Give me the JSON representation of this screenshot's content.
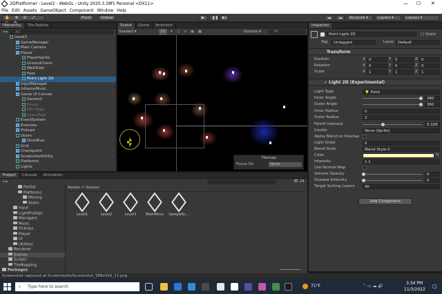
{
  "window": {
    "title": "2DPlatformer - Level2 - WebGL - Unity 2020.3.38f1 Personal <DX11>"
  },
  "menu": [
    "File",
    "Edit",
    "Assets",
    "GameObject",
    "Component",
    "Window",
    "Help"
  ],
  "toolbar": {
    "pivot": "Pivot",
    "global": "Global",
    "account": "Account",
    "layers": "Layers",
    "layout": "Layout"
  },
  "hierarchy": {
    "tabs": [
      "Hierarchy",
      "Tile Palette"
    ],
    "search_placeholder": "All",
    "items": [
      {
        "label": "Level2",
        "depth": 0
      },
      {
        "label": "GameManager",
        "depth": 1
      },
      {
        "label": "Main Camera",
        "depth": 1
      },
      {
        "label": "Player",
        "depth": 1
      },
      {
        "label": "PlayerSprite",
        "depth": 2
      },
      {
        "label": "GroundCheck",
        "depth": 2
      },
      {
        "label": "WallSlide",
        "depth": 2
      },
      {
        "label": "Feet",
        "depth": 2
      },
      {
        "label": "Point Light 2D",
        "depth": 2
      },
      {
        "label": "InputManager",
        "depth": 1
      },
      {
        "label": "InGameMusic",
        "depth": 1
      },
      {
        "label": "Game UI Canvas",
        "depth": 1
      },
      {
        "label": "GameUI",
        "depth": 2
      },
      {
        "label": "Pause",
        "depth": 2
      },
      {
        "label": "Win Page",
        "depth": 2
      },
      {
        "label": "Lose Page",
        "depth": 2
      },
      {
        "label": "EventSystem",
        "depth": 1
      },
      {
        "label": "Enemies",
        "depth": 1
      },
      {
        "label": "Pickups",
        "depth": 1
      },
      {
        "label": "Doors",
        "depth": 1
      },
      {
        "label": "DoorBlue",
        "depth": 2
      },
      {
        "label": "Grid",
        "depth": 1
      },
      {
        "label": "Checkpoint",
        "depth": 1
      },
      {
        "label": "ScreenshotUtility",
        "depth": 1
      },
      {
        "label": "Platforms",
        "depth": 1
      },
      {
        "label": "Lights",
        "depth": 1
      }
    ]
  },
  "scene": {
    "tabs": [
      "Scene",
      "Game",
      "Animator"
    ],
    "shading": "Shaded",
    "mode": "2D",
    "gizmos": "Gizmos",
    "search": "All",
    "tilemap": {
      "title": "Tilemap",
      "focus_label": "Focus On",
      "focus_value": "None"
    }
  },
  "inspector": {
    "tab": "Inspector",
    "object_name": "Point Light 2D",
    "static_label": "Static",
    "tag_label": "Tag",
    "tag": "Untagged",
    "layer_label": "Layer",
    "layer": "Default",
    "transform": {
      "title": "Transform",
      "rows": [
        {
          "label": "Position",
          "x": "0",
          "y": "0",
          "z": "0"
        },
        {
          "label": "Rotation",
          "x": "0",
          "y": "0",
          "z": "0"
        },
        {
          "label": "Scale",
          "x": "1",
          "y": "1",
          "z": "1"
        }
      ]
    },
    "light2d": {
      "title": "Light 2D (Experimental)",
      "light_type_label": "Light Type",
      "light_type": "Point",
      "inner_angle_label": "Inner Angle",
      "inner_angle": "360",
      "outer_angle_label": "Outer Angle",
      "outer_angle": "360",
      "inner_radius_label": "Inner Radius",
      "inner_radius": "0",
      "outer_radius_label": "Outer Radius",
      "outer_radius": "3",
      "falloff_label": "Falloff Intensity",
      "falloff": "0.326",
      "cookie_label": "Cookie",
      "cookie": "None (Sprite)",
      "alpha_blend_label": "Alpha Blend on Overlap",
      "light_order_label": "Light Order",
      "light_order": "0",
      "blend_style_label": "Blend Style",
      "blend_style": "Blend Style 0",
      "color_label": "Color",
      "color": "#fff5b0",
      "intensity_label": "Intensity",
      "intensity": "1.1",
      "normal_map_label": "Use Normal Map",
      "volume_label": "Volume Opacity",
      "volume": "0",
      "shadow_label": "Shadow Intensity",
      "shadow": "0",
      "sorting_label": "Target Sorting Layers",
      "sorting": "All"
    },
    "add_component": "Add Component"
  },
  "project": {
    "tabs": [
      "Project",
      "Console",
      "Animation"
    ],
    "count": "24",
    "breadcrumb": [
      "Assets",
      "Scenes"
    ],
    "folders": [
      {
        "label": "Partial",
        "depth": 2
      },
      {
        "label": "Platforms",
        "depth": 2
      },
      {
        "label": "Moving",
        "depth": 3
      },
      {
        "label": "Static",
        "depth": 3
      },
      {
        "label": "Input",
        "depth": 1
      },
      {
        "label": "LightPickUps",
        "depth": 1
      },
      {
        "label": "Managers",
        "depth": 1
      },
      {
        "label": "Music",
        "depth": 1
      },
      {
        "label": "PickUps",
        "depth": 1
      },
      {
        "label": "Player",
        "depth": 1
      },
      {
        "label": "UI",
        "depth": 1
      },
      {
        "label": "Utilities",
        "depth": 1
      },
      {
        "label": "Renderer",
        "depth": 0
      },
      {
        "label": "Scenes",
        "depth": 0
      },
      {
        "label": "Scripts",
        "depth": 0
      },
      {
        "label": "TileMapping",
        "depth": 0
      },
      {
        "label": "Packages",
        "depth": -1
      }
    ],
    "assets": [
      "Level1",
      "Level2",
      "Level3",
      "MainMenu",
      "SampleSc..."
    ]
  },
  "status": "Screenshot captured at Screenshots/Screenshot_588x420_11.png",
  "taskbar": {
    "search": "Type here to search",
    "weather": "71°F",
    "time": "3:34 PM",
    "date": "11/3/2022"
  }
}
